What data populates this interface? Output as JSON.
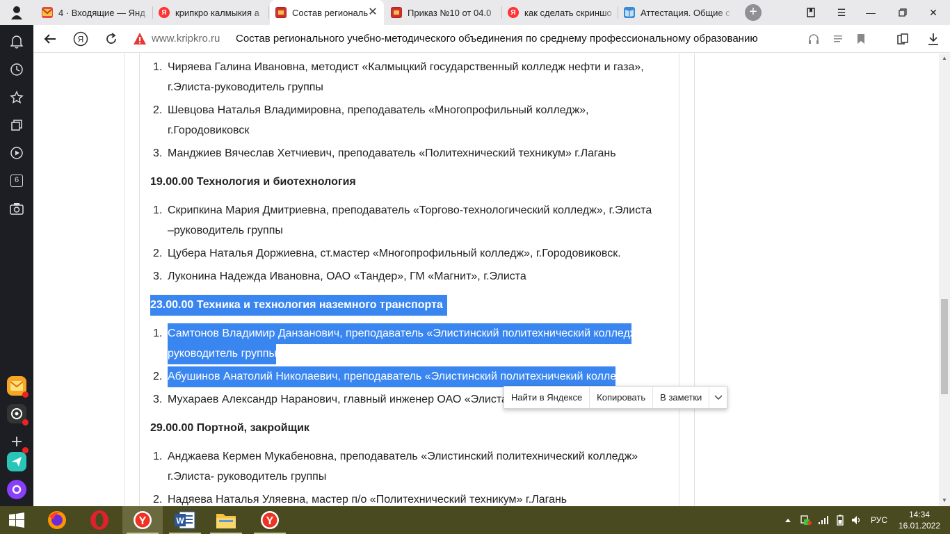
{
  "tabs": [
    {
      "title": "4 · Входящие — Янд",
      "favicon": "mail-icon",
      "color": "#e94b3c"
    },
    {
      "title": "крипкро калмыкия а",
      "favicon": "yandex-icon",
      "color": "#f33"
    },
    {
      "title": "Состав региональ",
      "favicon": "site-icon",
      "color": "#c33"
    },
    {
      "title": "Приказ №10 от 04.0",
      "favicon": "site-icon",
      "color": "#c33"
    },
    {
      "title": "как сделать скриншо",
      "favicon": "yandex-icon",
      "color": "#f33"
    },
    {
      "title": "Аттестация. Общие с",
      "favicon": "book-icon",
      "color": "#3a8ad6"
    }
  ],
  "address": {
    "domain": "www.kripkro.ru",
    "title": "Состав регионального учебно-методического объединения по среднему профессиональному образованию"
  },
  "sidebar": {
    "badge": "6"
  },
  "content": {
    "top_list": [
      {
        "num": "1.",
        "line1": "Чиряева Галина Ивановна, методист «Калмыцкий государственный колледж нефти и газа»,",
        "line2": "г.Элиста-руководитель группы"
      },
      {
        "num": "2.",
        "line1": "Шевцова Наталья Владимировна, преподаватель «Многопрофильный колледж»,",
        "line2": "г.Городовиковск"
      },
      {
        "num": "3.",
        "line1": "Манджиев Вячеслав Хетчиевич, преподаватель «Политехнический техникум» г.Лагань",
        "line2": ""
      }
    ],
    "section2": {
      "title": "19.00.00 Технология и биотехнология",
      "items": [
        {
          "num": "1.",
          "line1": "Скрипкина Мария Дмитриевна, преподаватель «Торгово-технологический колледж», г.Элиста",
          "line2": "–руководитель группы"
        },
        {
          "num": "2.",
          "line1": "Цубера Наталья Доржиевна, ст.мастер «Многопрофильный колледж», г.Городовиковск.",
          "line2": ""
        },
        {
          "num": "3.",
          "line1": "Луконина Надежда Ивановна, ОАО «Тандер», ГМ «Магнит», г.Элиста",
          "line2": ""
        }
      ]
    },
    "section3": {
      "title": "23.00.00 Техника и технология наземного транспорта",
      "items": [
        {
          "num": "1.",
          "line1": "Самтонов Владимир Данзанович, преподаватель «Элистинский политехнический колледж»-",
          "line2": "руководитель группы"
        },
        {
          "num": "2.",
          "line1": "Абушинов Анатолий Николаевич, преподаватель «Элистинский политехничекий колледж»",
          "line2": ""
        },
        {
          "num": "3.",
          "line1": "Мухараев Александр Наранович, главный инженер ОАО «Элиста-Л",
          "line2": ""
        }
      ]
    },
    "section4": {
      "title": "29.00.00 Портной, закройщик",
      "items": [
        {
          "num": "1.",
          "line1": "Анджаева Кермен Мукабеновна, преподаватель «Элистинский политехнический колледж»",
          "line2": "г.Элиста- руководитель группы"
        },
        {
          "num": "2.",
          "line1": "Надяева Наталья Уляевна, мастер п/о «Политехнический техникум» г.Лагань",
          "line2": ""
        }
      ]
    }
  },
  "popup": {
    "find": "Найти в Яндексе",
    "copy": "Копировать",
    "notes": "В заметки"
  },
  "tray": {
    "lang": "РУС",
    "time": "14:34",
    "date": "16.01.2022"
  },
  "colors": {
    "selection": "#3a86f0",
    "taskbar": "#4a4a20",
    "sidebar": "#1d1d24"
  }
}
